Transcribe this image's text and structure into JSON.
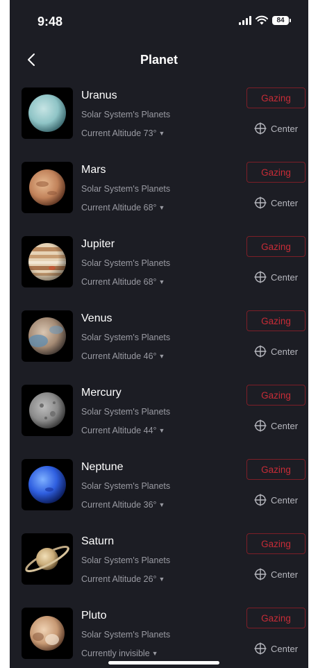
{
  "status": {
    "time": "9:48",
    "battery": "84"
  },
  "header": {
    "title": "Planet"
  },
  "gaze_label": "Gazing",
  "center_label": "Center",
  "planets": [
    {
      "name": "Uranus",
      "category": "Solar System's Planets",
      "altitude": "Current Altitude 73°"
    },
    {
      "name": "Mars",
      "category": "Solar System's Planets",
      "altitude": "Current Altitude 68°"
    },
    {
      "name": "Jupiter",
      "category": "Solar System's Planets",
      "altitude": "Current Altitude 68°"
    },
    {
      "name": "Venus",
      "category": "Solar System's Planets",
      "altitude": "Current Altitude 46°"
    },
    {
      "name": "Mercury",
      "category": "Solar System's Planets",
      "altitude": "Current Altitude 44°"
    },
    {
      "name": "Neptune",
      "category": "Solar System's Planets",
      "altitude": "Current Altitude 36°"
    },
    {
      "name": "Saturn",
      "category": "Solar System's Planets",
      "altitude": "Current Altitude 26°"
    },
    {
      "name": "Pluto",
      "category": "Solar System's Planets",
      "altitude": "Currently invisible"
    }
  ],
  "colors": {
    "background": "#1c1d24",
    "gazing_accent": "#c72c37",
    "secondary_text": "#9a9ba3"
  }
}
